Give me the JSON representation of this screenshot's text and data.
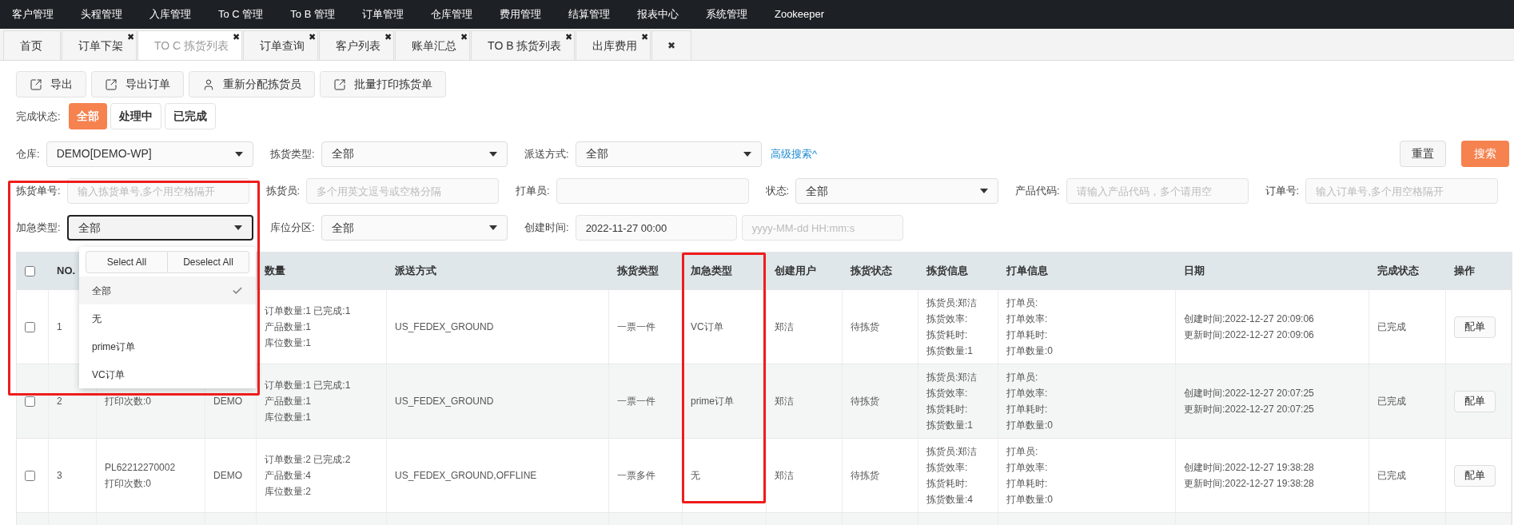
{
  "nav": {
    "items": [
      "客户管理",
      "头程管理",
      "入库管理",
      "To C 管理",
      "To B 管理",
      "订单管理",
      "仓库管理",
      "费用管理",
      "结算管理",
      "报表中心",
      "系统管理",
      "Zookeeper"
    ]
  },
  "tabs": [
    {
      "label": "首页",
      "selected": false,
      "closable": false
    },
    {
      "label": "订单下架",
      "selected": false,
      "closable": true
    },
    {
      "label": "TO C 拣货列表",
      "selected": true,
      "closable": true
    },
    {
      "label": "订单查询",
      "selected": false,
      "closable": true
    },
    {
      "label": "客户列表",
      "selected": false,
      "closable": true
    },
    {
      "label": "账单汇总",
      "selected": false,
      "closable": true
    },
    {
      "label": "TO B 拣货列表",
      "selected": false,
      "closable": true
    },
    {
      "label": "出库费用",
      "selected": false,
      "closable": true
    }
  ],
  "tab_close_all": "✖",
  "tab_close_mark": "✖",
  "toolbar": [
    {
      "label": "导出"
    },
    {
      "label": "导出订单"
    },
    {
      "label": "重新分配拣货员"
    },
    {
      "label": "批量打印拣货单"
    }
  ],
  "status_filter": {
    "label": "完成状态:",
    "options": [
      {
        "label": "全部",
        "selected": true
      },
      {
        "label": "处理中",
        "selected": false
      },
      {
        "label": "已完成",
        "selected": false
      }
    ]
  },
  "filters": [
    [
      {
        "label": "仓库:",
        "kind": "select",
        "value": "DEMO[DEMO-WP]"
      },
      {
        "label": "拣货类型:",
        "kind": "select",
        "value": "全部"
      },
      {
        "label": "派送方式:",
        "kind": "select",
        "value": "全部"
      }
    ],
    [
      {
        "label": "拣货单号:",
        "kind": "input",
        "placeholder": "输入拣货单号,多个用空格隔开"
      },
      {
        "label": "拣货员:",
        "kind": "input",
        "placeholder": "多个用英文逗号或空格分隔"
      },
      {
        "label": "打单员:",
        "kind": "input"
      },
      {
        "label": "状态:",
        "kind": "select",
        "value": "全部"
      },
      {
        "label": "产品代码:",
        "kind": "input",
        "placeholder": "请输入产品代码，多个请用空"
      },
      {
        "label": "订单号:",
        "kind": "input",
        "placeholder": "输入订单号,多个用空格隔开"
      }
    ],
    [
      {
        "label": "加急类型:",
        "kind": "select",
        "value": "全部",
        "focused": true
      },
      {
        "label": "库位分区:",
        "kind": "select",
        "value": "全部"
      },
      {
        "label": "创建时间:",
        "kind": "daterange",
        "value": "2022-11-27 00:00",
        "placeholder": "yyyy-MM-dd HH:mm:s"
      }
    ]
  ],
  "advanced_link": "高级搜索^",
  "reset_button": "重置",
  "search_button": "搜索",
  "dropdown": {
    "select_all": "Select All",
    "deselect_all": "Deselect All",
    "options": [
      {
        "label": "全部",
        "selected": true
      },
      {
        "label": "无",
        "selected": false
      },
      {
        "label": "prime订单",
        "selected": false
      },
      {
        "label": "VC订单",
        "selected": false
      }
    ]
  },
  "table": {
    "header_checked": false,
    "columns": {
      "no": "NO.",
      "quantity": "数量",
      "delivery": "派送方式",
      "pick_type": "拣货类型",
      "urgent": "加急类型",
      "user": "创建用户",
      "pick_status": "拣货状态",
      "pick_info": "拣货信息",
      "print_info": "打单信息",
      "date": "日期",
      "done": "完成状态",
      "action": "操作"
    },
    "rows": [
      {
        "checked": false,
        "no": "1",
        "column_3": [],
        "column_4": "",
        "quantity": [
          "订单数量:1 已完成:1",
          "产品数量:1",
          "库位数量:1"
        ],
        "delivery": "US_FEDEX_GROUND",
        "pick_type": "一票一件",
        "urgent": "VC订单",
        "user": "郑洁",
        "pick_status": "待拣货",
        "pick_info": [
          "拣货员:郑洁",
          "拣货效率:",
          "拣货耗时:",
          "拣货数量:1"
        ],
        "print_info": [
          "打单员:",
          "打单效率:",
          "打单耗时:",
          "打单数量:0"
        ],
        "date": [
          "创建时间:2022-12-27 20:09:06",
          "更新时间:2022-12-27 20:09:06"
        ],
        "done": "已完成",
        "action": "配单"
      },
      {
        "checked": false,
        "no": "2",
        "column_3": [
          "打印次数:0"
        ],
        "column_4": "DEMO",
        "quantity": [
          "订单数量:1 已完成:1",
          "产品数量:1",
          "库位数量:1"
        ],
        "delivery": "US_FEDEX_GROUND",
        "pick_type": "一票一件",
        "urgent": "prime订单",
        "user": "郑洁",
        "pick_status": "待拣货",
        "pick_info": [
          "拣货员:郑洁",
          "拣货效率:",
          "拣货耗时:",
          "拣货数量:1"
        ],
        "print_info": [
          "打单员:",
          "打单效率:",
          "打单耗时:",
          "打单数量:0"
        ],
        "date": [
          "创建时间:2022-12-27 20:07:25",
          "更新时间:2022-12-27 20:07:25"
        ],
        "done": "已完成",
        "action": "配单"
      },
      {
        "checked": false,
        "no": "3",
        "column_3": [
          "PL62212270002",
          "打印次数:0"
        ],
        "column_4": "DEMO",
        "quantity": [
          "订单数量:2 已完成:2",
          "产品数量:4",
          "库位数量:2"
        ],
        "delivery": "US_FEDEX_GROUND,OFFLINE",
        "pick_type": "一票多件",
        "urgent": "无",
        "user": "郑洁",
        "pick_status": "待拣货",
        "pick_info": [
          "拣货员:郑洁",
          "拣货效率:",
          "拣货耗时:",
          "拣货数量:4"
        ],
        "print_info": [
          "打单员:",
          "打单效率:",
          "打单耗时:",
          "打单数量:0"
        ],
        "date": [
          "创建时间:2022-12-27 19:38:28",
          "更新时间:2022-12-27 19:38:28"
        ],
        "done": "已完成",
        "action": "配单"
      }
    ]
  }
}
